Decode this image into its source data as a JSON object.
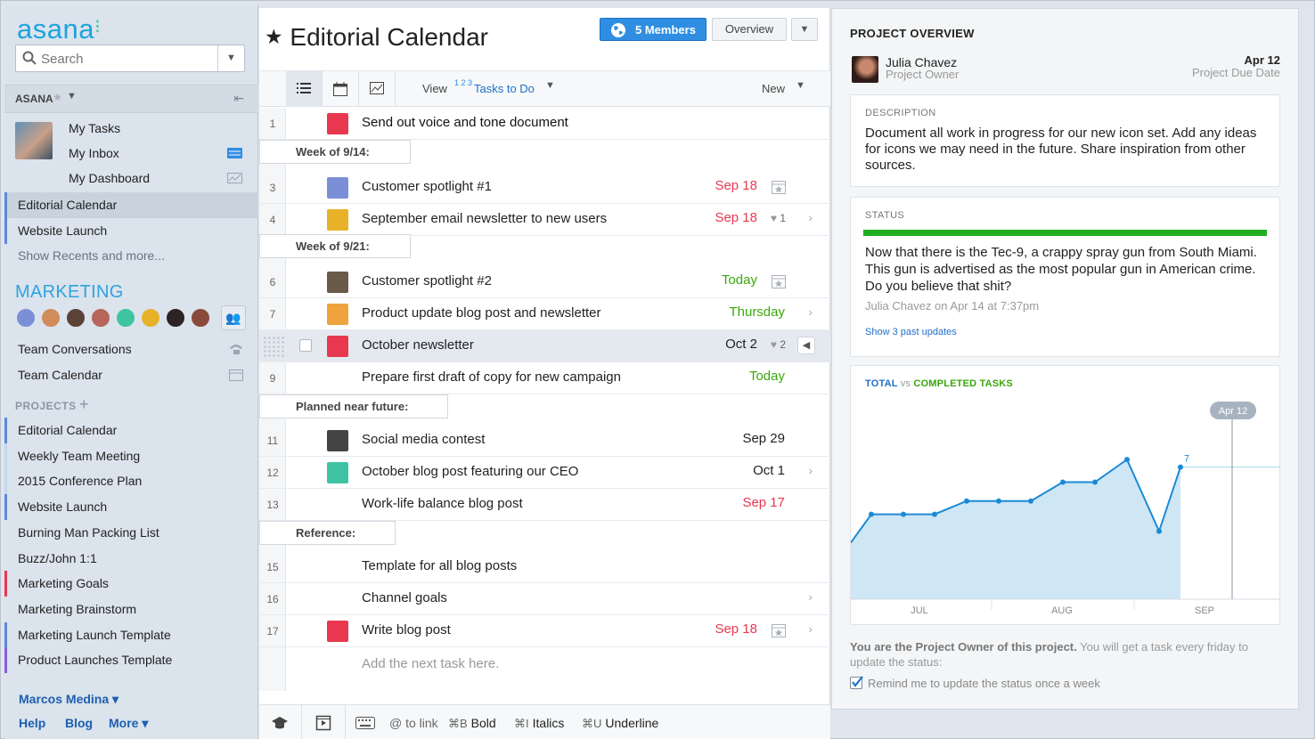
{
  "app": {
    "logo": "asana"
  },
  "sidebar": {
    "search_placeholder": "Search",
    "org_name": "ASANA",
    "my_links": [
      "My Tasks",
      "My Inbox",
      "My Dashboard"
    ],
    "recents": [
      "Editorial Calendar",
      "Website Launch",
      "Show Recents and more..."
    ],
    "team_name": "MARKETING",
    "team_links": [
      "Team Conversations",
      "Team Calendar"
    ],
    "projects_header": "PROJECTS",
    "projects": [
      {
        "name": "Editorial Calendar",
        "color": "#5d8ad6"
      },
      {
        "name": "Weekly Team Meeting",
        "color": "#c2d7ec"
      },
      {
        "name": "2015 Conference Plan",
        "color": "#c2d7ec"
      },
      {
        "name": "Website Launch",
        "color": "#5d8ad6"
      },
      {
        "name": "Burning Man Packing List",
        "color": "#dbe3ec"
      },
      {
        "name": "Buzz/John 1:1",
        "color": "#dbe3ec"
      },
      {
        "name": "Marketing Goals",
        "color": "#e8384f"
      },
      {
        "name": "Marketing Brainstorm",
        "color": "#dbe3ec"
      },
      {
        "name": "Marketing Launch Template",
        "color": "#5d8ad6"
      },
      {
        "name": "Product Launches Template",
        "color": "#8a5fd6"
      }
    ],
    "user": "Marcos Medina",
    "footer_links": [
      "Help",
      "Blog",
      "More"
    ]
  },
  "project": {
    "title": "Editorial Calendar",
    "members_label": "5 Members",
    "overview_label": "Overview",
    "view_label": "View",
    "view_num": "1 2 3",
    "view_value": "Tasks to Do",
    "new_label": "New",
    "add_task_placeholder": "Add the next task here."
  },
  "tasks": [
    {
      "num": "1",
      "name": "Send out voice and tone document",
      "due": "",
      "bold": true
    },
    {
      "section": "Week of 9/14:"
    },
    {
      "num": "3",
      "name": "Customer spotlight #1",
      "due": "Sep 18",
      "due_color": "red"
    },
    {
      "num": "4",
      "name": "September email newsletter to new users",
      "due": "Sep 18",
      "due_color": "red",
      "likes": "1"
    },
    {
      "section": "Week of 9/21:"
    },
    {
      "num": "6",
      "name": "Customer spotlight #2",
      "due": "Today",
      "due_color": "green"
    },
    {
      "num": "7",
      "name": "Product update blog post and newsletter",
      "due": "Thursday",
      "due_color": "green"
    },
    {
      "num": "",
      "name": "October newsletter",
      "due": "Oct 2",
      "due_color": "dark",
      "likes": "2",
      "selected": true
    },
    {
      "num": "9",
      "name": "Prepare first draft of copy for new campaign",
      "due": "Today",
      "due_color": "green"
    },
    {
      "section": "Planned near future:"
    },
    {
      "num": "11",
      "name": "Social media contest",
      "due": "Sep 29",
      "due_color": "dark"
    },
    {
      "num": "12",
      "name": "October blog post featuring our CEO",
      "due": "Oct 1",
      "due_color": "dark"
    },
    {
      "num": "13",
      "name": "Work-life balance blog post",
      "due": "Sep 17",
      "due_color": "red"
    },
    {
      "section": "Reference:"
    },
    {
      "num": "15",
      "name": "Template for all blog posts",
      "due": ""
    },
    {
      "num": "16",
      "name": "Channel goals",
      "due": ""
    },
    {
      "num": "17",
      "name": "Write blog post",
      "due": "Sep 18",
      "due_color": "red"
    }
  ],
  "editor_hints": [
    {
      "key": "",
      "label": "@ to link"
    },
    {
      "key": "⌘B",
      "label": "Bold"
    },
    {
      "key": "⌘I",
      "label": "Italics"
    },
    {
      "key": "⌘U",
      "label": "Underline"
    }
  ],
  "overview": {
    "header": "PROJECT OVERVIEW",
    "owner_name": "Julia Chavez",
    "owner_role": "Project Owner",
    "due_date": "Apr 12",
    "due_label": "Project Due Date",
    "description_header": "DESCRIPTION",
    "description": "Document all work in progress for our new icon set. Add any ideas for icons we may need in the future. Share inspiration from other sources.",
    "status_header": "STATUS",
    "status_color": "#1fae1f",
    "status_text": "Now that there is the Tec-9, a crappy spray gun from South Miami. This gun is advertised as the most popular gun in American crime. Do you believe that shit?",
    "status_by": "Julia Chavez on Apr 14 at 7:37pm",
    "status_more": "Show 3 past updates",
    "owner_note_bold": "You are the Project Owner of this project.",
    "owner_note": "You will get a task every friday to update the status:",
    "remind_label": "Remind me to update the status once a week"
  },
  "chart_data": {
    "type": "area",
    "title_total": "TOTAL",
    "title_vs": "vs",
    "title_completed": "COMPLETED TASKS",
    "x_ticks": [
      "JUL",
      "AUG",
      "SEP"
    ],
    "series": [
      {
        "values": [
          3.0,
          4.5,
          4.5,
          4.5,
          5.2,
          5.2,
          5.2,
          6.2,
          6.2,
          7.4,
          3.6,
          7.0
        ]
      }
    ],
    "total_level": 7,
    "label_value": "7",
    "marker_label": "Apr 12",
    "ylim": [
      0,
      10
    ],
    "grid": false
  }
}
